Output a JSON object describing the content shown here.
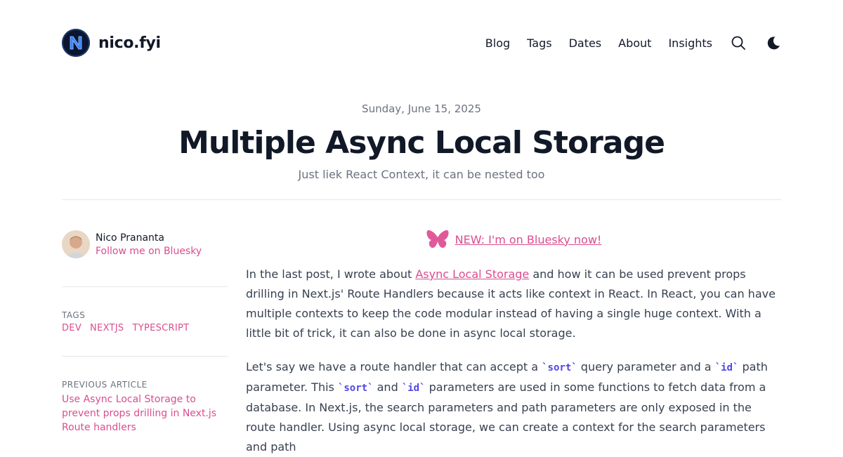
{
  "site": {
    "name": "nico.fyi",
    "nav": [
      "Blog",
      "Tags",
      "Dates",
      "About",
      "Insights"
    ]
  },
  "article": {
    "date": "Sunday, June 15, 2025",
    "title": "Multiple Async Local Storage",
    "subtitle": "Just liek React Context, it can be nested too"
  },
  "sidebar": {
    "author_name": "Nico Prananta",
    "author_link": "Follow me on Bluesky",
    "tags_label": "TAGS",
    "tags": [
      "DEV",
      "NEXTJS",
      "TYPESCRIPT"
    ],
    "prev_label": "PREVIOUS ARTICLE",
    "prev_title": "Use Async Local Storage to prevent props drilling in Next.js Route handlers"
  },
  "content": {
    "banner": "NEW: I'm on Bluesky now!",
    "p1": {
      "before": "In the last post, I wrote about ",
      "link": "Async Local Storage",
      "after": " and how it can be used prevent props drilling in Next.js' Route Handlers because it acts like context in React. In React, you can have multiple contexts to keep the code modular instead of having a single huge context. With a little bit of trick, it can also be done in async local storage."
    },
    "p2": {
      "t1": "Let's say we have a route handler that can accept a ",
      "c1": "`sort`",
      "t2": " query parameter and a ",
      "c2": "`id`",
      "t3": " path parameter. This ",
      "c3": "`sort`",
      "t4": " and ",
      "c4": "`id`",
      "t5": " parameters are used in some functions to fetch data from a database. In Next.js, the search parameters and path parameters are only exposed in the route handler. Using async local storage, we can create a context for the search parameters and path"
    }
  },
  "colors": {
    "accent": "#db4d8f",
    "text": "#111827",
    "muted": "#6b7280",
    "code": "#4f46e5"
  }
}
